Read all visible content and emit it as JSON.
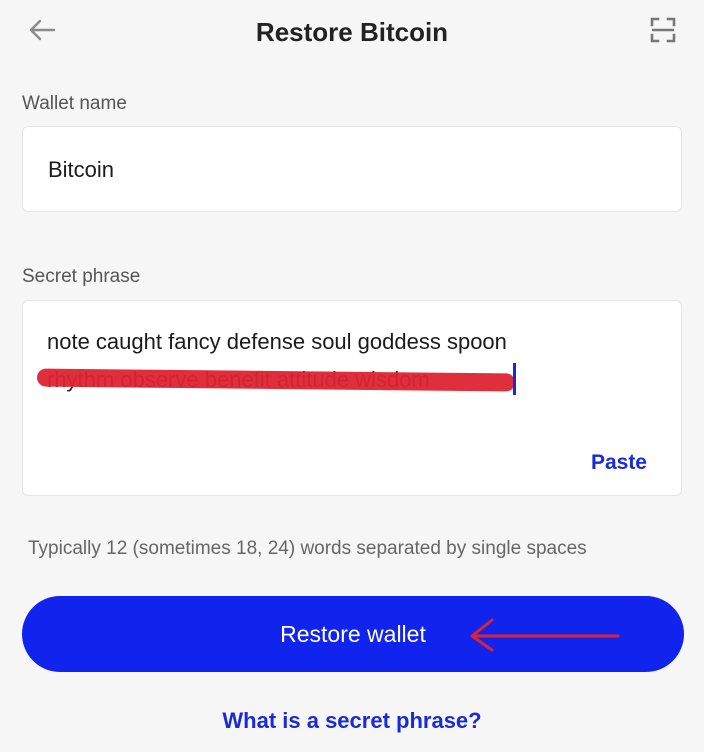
{
  "header": {
    "title": "Restore Bitcoin",
    "back_icon": "arrow-left-icon",
    "scan_icon": "scan-qr-icon"
  },
  "wallet_name": {
    "label": "Wallet name",
    "value": "Bitcoin"
  },
  "secret_phrase": {
    "label": "Secret phrase",
    "line1": "note caught fancy defense soul goddess spoon",
    "line2": "rhythm observe benefit attitude wisdom",
    "line2_redacted": true,
    "paste_label": "Paste"
  },
  "hint": "Typically 12 (sometimes 18, 24) words separated by single spaces",
  "restore_button": {
    "label": "Restore wallet"
  },
  "help_link": "What is a secret phrase?",
  "colors": {
    "accent": "#1024ee",
    "link": "#1a2bd6",
    "annotation": "#dd2331",
    "background": "#f6f6f6"
  }
}
